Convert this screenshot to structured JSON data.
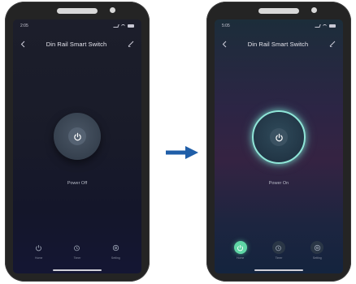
{
  "left": {
    "status_time": "2:05",
    "title": "Din Rail Smart Switch",
    "power_state": "Power Off",
    "tabs": [
      {
        "label": "Home",
        "icon": "power-icon",
        "active": false
      },
      {
        "label": "Timer",
        "icon": "timer-icon",
        "active": false
      },
      {
        "label": "Setting",
        "icon": "settings-icon",
        "active": false
      }
    ]
  },
  "right": {
    "status_time": "5:05",
    "title": "Din Rail Smart Switch",
    "power_state": "Power On",
    "tabs": [
      {
        "label": "Home",
        "icon": "power-icon",
        "active": true
      },
      {
        "label": "Timer",
        "icon": "timer-icon",
        "active": false
      },
      {
        "label": "Setting",
        "icon": "settings-icon",
        "active": false
      }
    ]
  },
  "colors": {
    "accent_on": "#5fd6a5",
    "ring_glow": "#8fe6d8",
    "arrow": "#1f5ea8"
  }
}
